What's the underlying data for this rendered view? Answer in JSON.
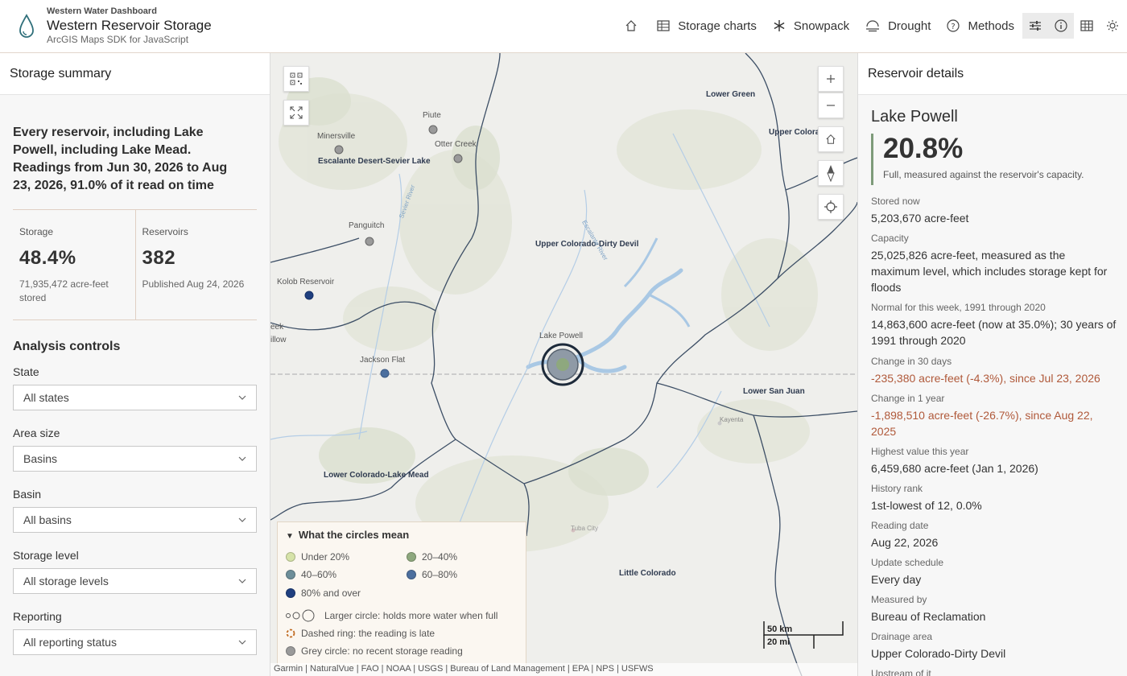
{
  "header": {
    "kicker": "Western Water Dashboard",
    "title": "Western Reservoir Storage",
    "subtitle": "ArcGIS Maps SDK for JavaScript",
    "nav": [
      {
        "label": "Storage charts"
      },
      {
        "label": "Snowpack"
      },
      {
        "label": "Drought"
      },
      {
        "label": "Methods"
      }
    ]
  },
  "left": {
    "panel_title": "Storage summary",
    "summary": "Every reservoir, including Lake Powell, including Lake Mead. Readings from Jun 30, 2026 to Aug 23, 2026, 91.0% of it read on time",
    "stats": [
      {
        "label": "Storage",
        "value": "48.4%",
        "note": "71,935,472 acre-feet stored"
      },
      {
        "label": "Reservoirs",
        "value": "382",
        "note": "Published Aug 24, 2026"
      }
    ],
    "controls_title": "Analysis controls",
    "controls": [
      {
        "label": "State",
        "value": "All states"
      },
      {
        "label": "Area size",
        "value": "Basins"
      },
      {
        "label": "Basin",
        "value": "All basins"
      },
      {
        "label": "Storage level",
        "value": "All storage levels"
      },
      {
        "label": "Reporting",
        "value": "All reporting status"
      }
    ]
  },
  "map": {
    "labels": {
      "lower_green": "Lower Green",
      "upper_colorado_cut": "Upper Colora",
      "minersville": "Minersville",
      "piute": "Piute",
      "otter_creek": "Otter Creek",
      "escalante": "Escalante Desert-Sevier Lake",
      "panguitch": "Panguitch",
      "upper_colorado_dirty_devil": "Upper Colorado-Dirty Devil",
      "kolob": "Kolob Reservoir",
      "eek": "eek",
      "illow": "illow",
      "lake_powell": "Lake Powell",
      "jackson_flat": "Jackson Flat",
      "lower_san_juan": "Lower San Juan",
      "kayenta": "Kayenta",
      "lower_colorado_lake_mead": "Lower Colorado-Lake Mead",
      "tuba_city": "Tuba City",
      "little_colorado": "Little Colorado",
      "sevier_river": "Sevier River",
      "escalante_river": "Escalante River"
    },
    "legend": {
      "title": "What the circles mean",
      "classes": [
        {
          "label": "Under 20%",
          "color": "#d6e3a8"
        },
        {
          "label": "20–40%",
          "color": "#8ea87e"
        },
        {
          "label": "40–60%",
          "color": "#6d8e99"
        },
        {
          "label": "60–80%",
          "color": "#4c6f9e"
        },
        {
          "label": "80% and over",
          "color": "#1f3f7f"
        }
      ],
      "size_note": "Larger circle: holds more water when full",
      "dashed_note": "Dashed ring: the reading is late",
      "grey_note": "Grey circle: no recent storage reading"
    },
    "scale": {
      "km": "50 km",
      "mi": "20 mi"
    },
    "attribution": "Garmin | NaturalVue | FAO | NOAA | USGS | Bureau of Land Management | EPA | NPS | USFWS"
  },
  "right": {
    "panel_title": "Reservoir details",
    "name": "Lake Powell",
    "percent": "20.8%",
    "percent_note": "Full, measured against the reservoir's capacity.",
    "fields": [
      {
        "key": "Stored now",
        "value": "5,203,670 acre-feet"
      },
      {
        "key": "Capacity",
        "value": "25,025,826 acre-feet, measured as the maximum level, which includes storage kept for floods"
      },
      {
        "key": "Normal for this week, 1991 through 2020",
        "value": "14,863,600 acre-feet (now at 35.0%); 30 years of 1991 through 2020"
      },
      {
        "key": "Change in 30 days",
        "value": "-235,380 acre-feet (-4.3%), since Jul 23, 2026"
      },
      {
        "key": "Change in 1 year",
        "value": "-1,898,510 acre-feet (-26.7%), since Aug 22, 2025"
      },
      {
        "key": "Highest value this year",
        "value": "6,459,680 acre-feet (Jan 1, 2026)"
      },
      {
        "key": "History rank",
        "value": "1st-lowest of 12, 0.0%"
      },
      {
        "key": "Reading date",
        "value": "Aug 22, 2026"
      },
      {
        "key": "Update schedule",
        "value": "Every day"
      },
      {
        "key": "Measured by",
        "value": "Bureau of Reclamation"
      },
      {
        "key": "Drainage area",
        "value": "Upper Colorado-Dirty Devil"
      },
      {
        "key": "Upstream of it",
        "value": ""
      }
    ],
    "negative_color": "#b0593a",
    "accent_color": "#7e9b7a"
  }
}
